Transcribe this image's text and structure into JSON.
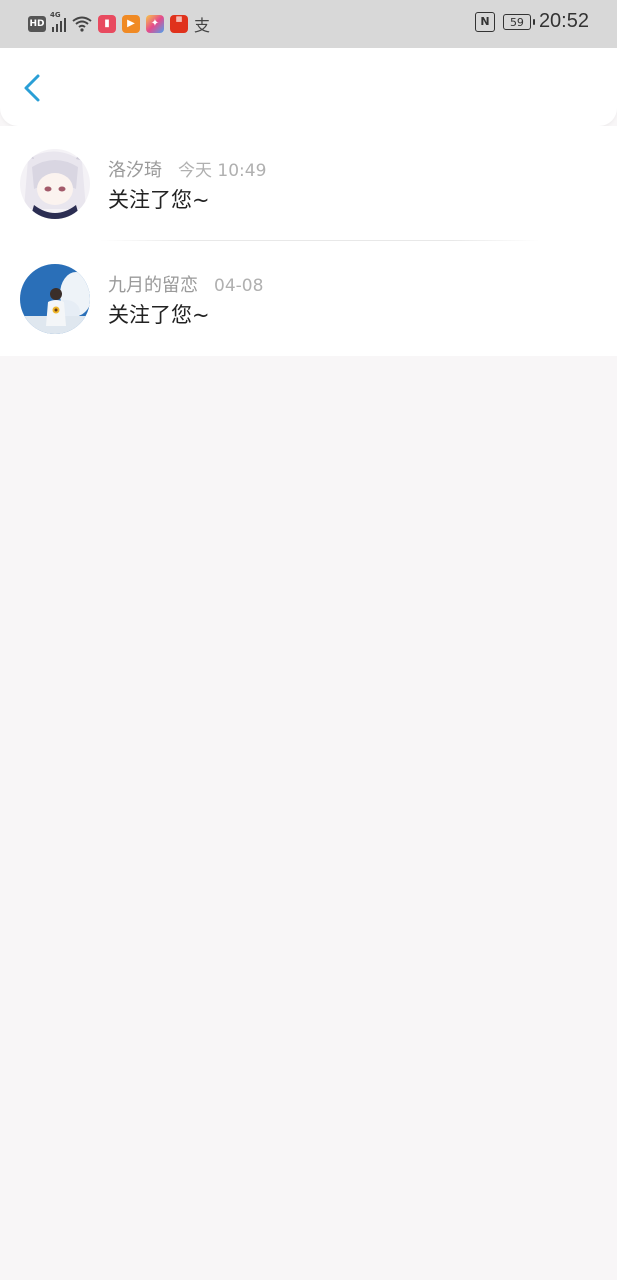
{
  "status_bar": {
    "hd_label": "HD",
    "network_label": "4G",
    "time": "20:52",
    "battery": "59",
    "nfc_label": "N",
    "alipay_char": "支"
  },
  "header": {
    "back_icon": "chevron-left-icon",
    "accent_color": "#2a9fd6"
  },
  "notifications": [
    {
      "name": "洛汐琦",
      "time": "今天 10:49",
      "message": "关注了您~"
    },
    {
      "name": "九月的留恋",
      "time": "04-08",
      "message": "关注了您~"
    }
  ]
}
